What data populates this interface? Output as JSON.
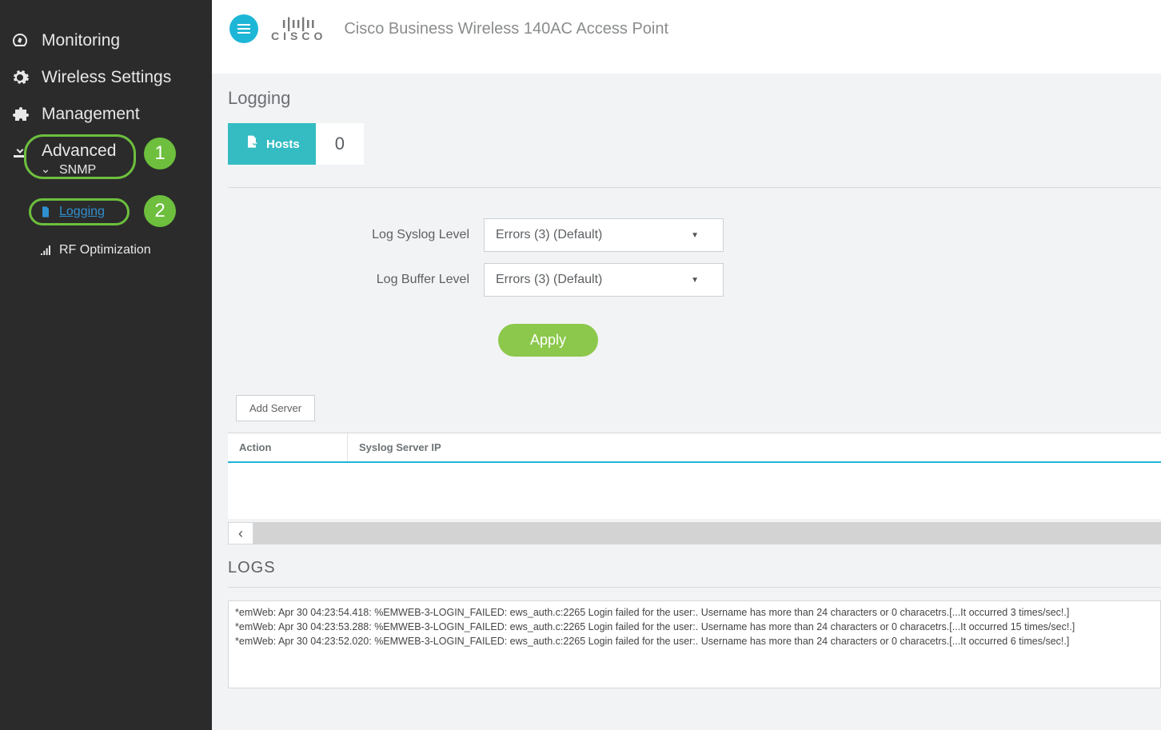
{
  "header": {
    "product_title": "Cisco Business Wireless 140AC Access Point",
    "logo_text_top": "ı|ıı|ıı",
    "logo_text_bottom": "CISCO"
  },
  "sidebar": {
    "items": [
      {
        "label": "Monitoring"
      },
      {
        "label": "Wireless Settings"
      },
      {
        "label": "Management"
      },
      {
        "label": "Advanced"
      }
    ],
    "advanced_sub": [
      {
        "label": "SNMP"
      },
      {
        "label": "Logging"
      },
      {
        "label": "RF Optimization"
      }
    ]
  },
  "callouts": {
    "one": "1",
    "two": "2"
  },
  "page": {
    "title": "Logging",
    "hosts_label": "Hosts",
    "hosts_count": "0"
  },
  "form": {
    "syslog_label": "Log Syslog Level",
    "syslog_value": "Errors (3) (Default)",
    "buffer_label": "Log Buffer Level",
    "buffer_value": "Errors (3) (Default)",
    "apply_label": "Apply"
  },
  "server_section": {
    "add_server_label": "Add Server",
    "columns": {
      "action": "Action",
      "ip": "Syslog Server IP"
    }
  },
  "logs": {
    "title": "LOGS",
    "entries": [
      "*emWeb: Apr 30 04:23:54.418: %EMWEB-3-LOGIN_FAILED: ews_auth.c:2265 Login failed for the user:. Username has more than 24 characters or 0 characetrs.[...It occurred 3 times/sec!.]",
      "*emWeb: Apr 30 04:23:53.288: %EMWEB-3-LOGIN_FAILED: ews_auth.c:2265 Login failed for the user:. Username has more than 24 characters or 0 characetrs.[...It occurred 15 times/sec!.]",
      "*emWeb: Apr 30 04:23:52.020: %EMWEB-3-LOGIN_FAILED: ews_auth.c:2265 Login failed for the user:. Username has more than 24 characters or 0 characetrs.[...It occurred 6 times/sec!.]"
    ]
  }
}
